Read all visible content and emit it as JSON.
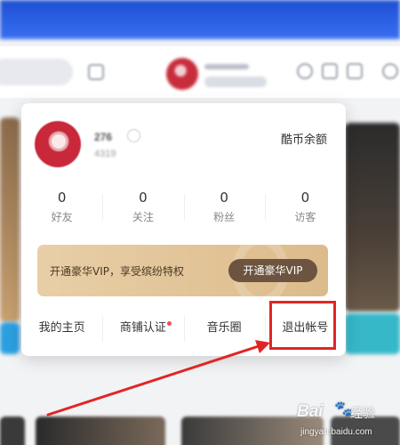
{
  "user": {
    "name": "276",
    "id": "4319",
    "balance_label": "酷币余额"
  },
  "stats": [
    {
      "value": "0",
      "label": "好友"
    },
    {
      "value": "0",
      "label": "关注"
    },
    {
      "value": "0",
      "label": "粉丝"
    },
    {
      "value": "0",
      "label": "访客"
    }
  ],
  "vip": {
    "promo_text": "开通豪华VIP，享受缤纷特权",
    "button_label": "开通豪华VIP"
  },
  "menu": {
    "items": [
      {
        "label": "我的主页"
      },
      {
        "label": "商铺认证"
      },
      {
        "label": "音乐圈"
      },
      {
        "label": "退出帐号"
      }
    ]
  },
  "colors": {
    "vip_banner": "#e2c598",
    "vip_button": "#6c5440",
    "highlight": "#e12525",
    "notification_dot": "#f04e4e"
  },
  "watermark": {
    "brand": "Bai",
    "brand_suffix": "经验",
    "url": "jingyan.baidu.com"
  }
}
